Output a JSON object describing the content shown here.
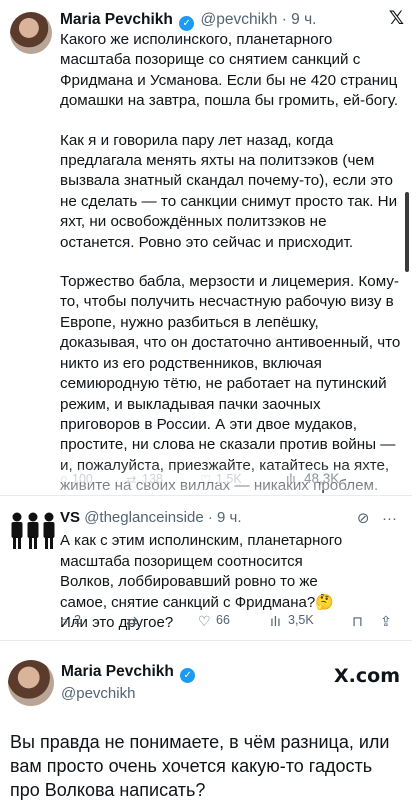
{
  "tweet1": {
    "name": "Maria Pevchikh",
    "handle_time": "@pevchikh · 9 ч.",
    "paragraphs": [
      "Какого же исполинского, планетарного масштаба позорище со снятием санкций с Фридмана и Усманова. Если бы не 420 страниц домашки на завтра, пошла бы громить, ей-богу.",
      "Как я и говорила пару лет назад, когда предлагала менять яхты на политзэков (чем вызвала знатный скандал почему-то), если это не сделать — то санкции снимут просто так. Ни яхт, ни освобождённых политзэков не останется. Ровно это сейчас и присходит.",
      "Торжество бабла, мерзости и лицемерия. Кому-то, чтобы получить несчастную рабочую визу в Европе, нужно разбиться в лепёшку, доказывая, что он достаточно антивоенный, что никто из его родственников, включая семиюродную тётю, не работает на путинский режим, и выкладывая пачки заочных приговоров в России. А эти двое мудаков, простите, ни слова не сказали против войны — и, пожалуйста, приезжайте, катайтесь на яхте, живите на своих виллах — никаких проблем."
    ],
    "stats": {
      "replies": "100",
      "reposts": "138",
      "likes": "1,5K",
      "views": "48,3K"
    }
  },
  "tweet2": {
    "name": "VS",
    "handle_time": "@theglanceinside · 9 ч.",
    "text": "А как с этим исполинским, планетарного масштаба позорищем соотносится Волков, лоббировавший ровно то же самое, снятие санкций с Фридмана?🤔 Или это другое?",
    "stats": {
      "replies": "2",
      "reposts": "",
      "likes": "66",
      "views": "3,5K"
    }
  },
  "tweet3": {
    "name": "Maria Pevchikh",
    "handle": "@pevchikh",
    "brand": "X.com",
    "text": "Вы правда не понимаете, в чём разница, или вам просто очень хочется какую-то гадость про Волкова написать?"
  },
  "colors": {
    "accent": "#1d9bf0",
    "muted": "#536471"
  },
  "icons": [
    "verified-badge-icon",
    "x-logo-icon",
    "reply-icon",
    "repost-icon",
    "like-icon",
    "views-icon",
    "bookmark-icon",
    "share-icon",
    "grok-icon",
    "more-icon"
  ]
}
